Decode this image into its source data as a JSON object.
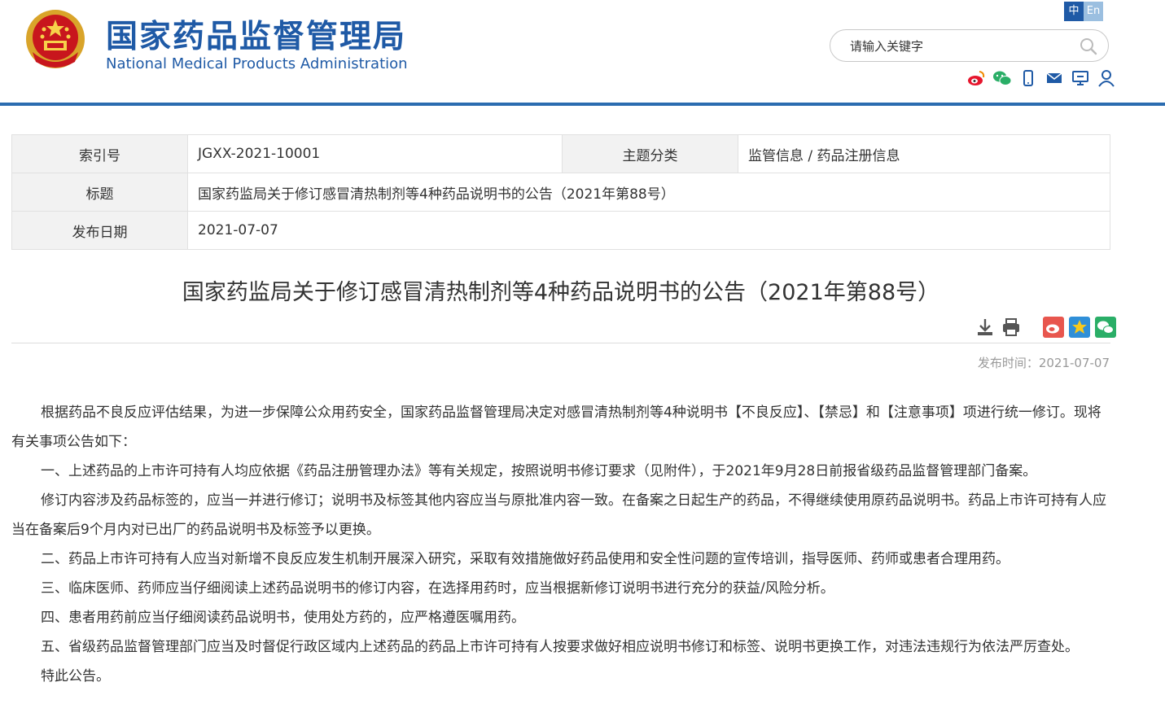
{
  "header": {
    "site_name_cn": "国家药品监督管理局",
    "site_name_en": "National Medical Products Administration",
    "lang": {
      "zh": "中",
      "en": "En"
    },
    "search_placeholder": "请输入关键字",
    "social_icons": [
      "weibo-icon",
      "wechat-icon",
      "mobile-icon",
      "mail-icon",
      "monitor-icon",
      "user-icon"
    ],
    "accent_color": "#1f5aa6"
  },
  "meta": {
    "index_label": "索引号",
    "index_value": "JGXX-2021-10001",
    "category_label": "主题分类",
    "category_value": "监管信息 / 药品注册信息",
    "title_label": "标题",
    "title_value": "国家药监局关于修订感冒清热制剂等4种药品说明书的公告（2021年第88号）",
    "date_label": "发布日期",
    "date_value": "2021-07-07"
  },
  "article": {
    "title": "国家药监局关于修订感冒清热制剂等4种药品说明书的公告（2021年第88号）",
    "tool_icons": [
      "download-icon",
      "print-icon",
      "share-weibo-icon",
      "share-qzone-icon",
      "share-wechat-icon"
    ],
    "publish_time": "发布时间：2021-07-07",
    "paragraphs": [
      "根据药品不良反应评估结果，为进一步保障公众用药安全，国家药品监督管理局决定对感冒清热制剂等4种说明书【不良反应】、【禁忌】和【注意事项】项进行统一修订。现将有关事项公告如下：",
      "一、上述药品的上市许可持有人均应依据《药品注册管理办法》等有关规定，按照说明书修订要求（见附件），于2021年9月28日前报省级药品监督管理部门备案。",
      "修订内容涉及药品标签的，应当一并进行修订；说明书及标签其他内容应当与原批准内容一致。在备案之日起生产的药品，不得继续使用原药品说明书。药品上市许可持有人应当在备案后9个月内对已出厂的药品说明书及标签予以更换。",
      "二、药品上市许可持有人应当对新增不良反应发生机制开展深入研究，采取有效措施做好药品使用和安全性问题的宣传培训，指导医师、药师或患者合理用药。",
      "三、临床医师、药师应当仔细阅读上述药品说明书的修订内容，在选择用药时，应当根据新修订说明书进行充分的获益/风险分析。",
      "四、患者用药前应当仔细阅读药品说明书，使用处方药的，应严格遵医嘱用药。",
      "五、省级药品监督管理部门应当及时督促行政区域内上述药品的药品上市许可持有人按要求做好相应说明书修订和标签、说明书更换工作，对违法违规行为依法严厉查处。",
      "特此公告。"
    ]
  }
}
